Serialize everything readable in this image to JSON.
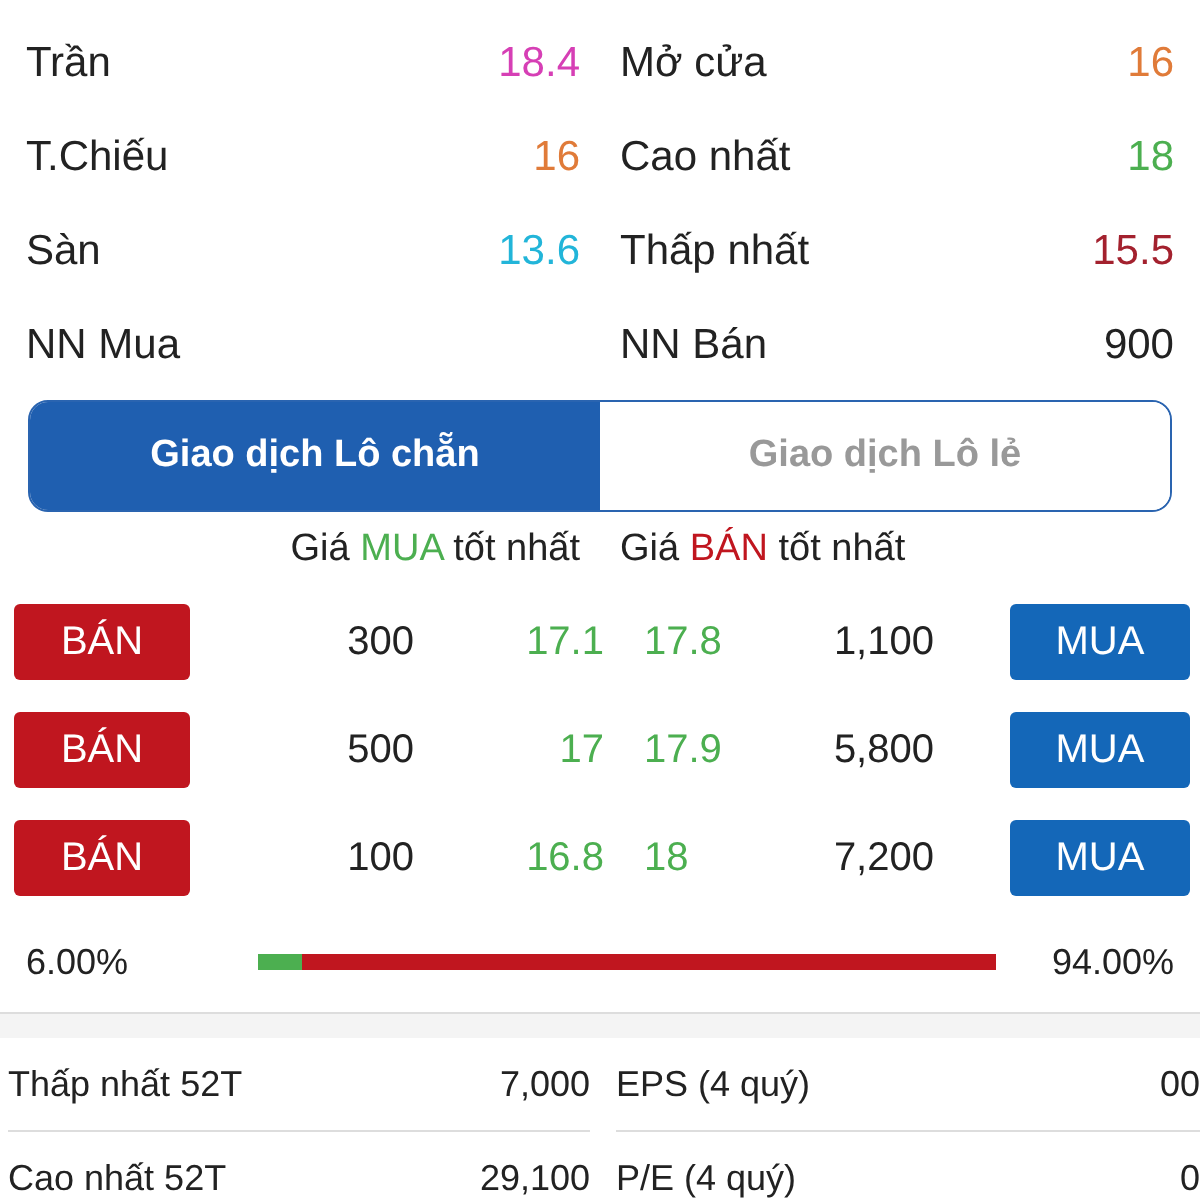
{
  "stats": [
    {
      "label": "Trần",
      "value": "18.4",
      "color": "#d63fb5"
    },
    {
      "label": "Mở cửa",
      "value": "16",
      "color": "#e07b39"
    },
    {
      "label": "T.Chiếu",
      "value": "16",
      "color": "#e07b39"
    },
    {
      "label": "Cao nhất",
      "value": "18",
      "color": "#4caf50"
    },
    {
      "label": "Sàn",
      "value": "13.6",
      "color": "#22b5d9"
    },
    {
      "label": "Thấp nhất",
      "value": "15.5",
      "color": "#a3212e"
    },
    {
      "label": "NN Mua"
    },
    {
      "label": "NN Bán",
      "value": "900",
      "color": "#222222"
    }
  ],
  "tabs": [
    {
      "label": "Giao dịch Lô chẵn",
      "selected": true
    },
    {
      "label": "Giao dịch Lô lẻ",
      "selected": false
    }
  ],
  "headers": [
    {
      "before": "Giá",
      "highlight": "MUA",
      "after": "tốt nhất",
      "color": "#4caf50"
    },
    {
      "before": "Giá",
      "highlight": "BÁN",
      "after": "tốt nhất",
      "color": "#c0161f"
    }
  ],
  "orders": [
    {
      "sell_button": "BÁN",
      "bid_volume": "300",
      "bid_price": "17.1",
      "ask_price": "17.8",
      "ask_volume": "1,100",
      "buy_button": "MUA"
    },
    {
      "sell_button": "BÁN",
      "bid_volume": "500",
      "bid_price": "17",
      "ask_price": "17.9",
      "ask_volume": "5,800",
      "buy_button": "MUA"
    },
    {
      "sell_button": "BÁN",
      "bid_volume": "100",
      "bid_price": "16.8",
      "ask_price": "18",
      "ask_volume": "7,200",
      "buy_button": "MUA"
    }
  ],
  "ratio": {
    "buy_label": "6.00%",
    "sell_label": "94.00%",
    "level": 0.06
  },
  "fundamentals": [
    {
      "label": "Thấp nhất 52T",
      "value": "7,000"
    },
    {
      "label": "EPS (4 quý)",
      "value": "00"
    },
    {
      "label": "Cao nhất 52T",
      "value": "29,100"
    },
    {
      "label": "P/E (4 quý)",
      "value": "0"
    }
  ]
}
